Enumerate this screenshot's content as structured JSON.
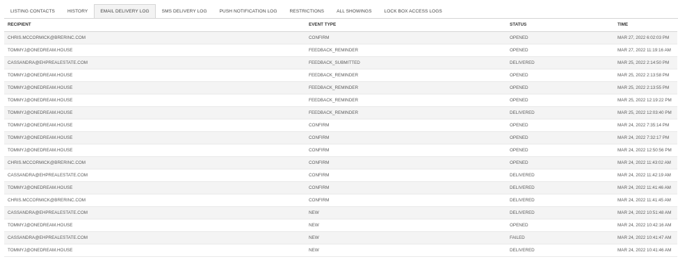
{
  "tabs": [
    {
      "label": "LISTING CONTACTS",
      "active": false
    },
    {
      "label": "HISTORY",
      "active": false
    },
    {
      "label": "EMAIL DELIVERY LOG",
      "active": true
    },
    {
      "label": "SMS DELIVERY LOG",
      "active": false
    },
    {
      "label": "PUSH NOTIFICATION LOG",
      "active": false
    },
    {
      "label": "RESTRICTIONS",
      "active": false
    },
    {
      "label": "ALL SHOWINGS",
      "active": false
    },
    {
      "label": "LOCK BOX ACCESS LOGS",
      "active": false
    }
  ],
  "table": {
    "columns": [
      "RECIPIENT",
      "EVENT TYPE",
      "STATUS",
      "TIME"
    ],
    "rows": [
      [
        "CHRIS.MCCORMICK@BRERINC.COM",
        "CONFIRM",
        "OPENED",
        "MAR 27, 2022 6:02:03 PM"
      ],
      [
        "TOMMYJ@ONEDREAM.HOUSE",
        "FEEDBACK_REMINDER",
        "OPENED",
        "MAR 27, 2022 11:19:16 AM"
      ],
      [
        "CASSANDRA@EHPREALESTATE.COM",
        "FEEDBACK_SUBMITTED",
        "DELIVERED",
        "MAR 25, 2022 2:14:50 PM"
      ],
      [
        "TOMMYJ@ONEDREAM.HOUSE",
        "FEEDBACK_REMINDER",
        "OPENED",
        "MAR 25, 2022 2:13:58 PM"
      ],
      [
        "TOMMYJ@ONEDREAM.HOUSE",
        "FEEDBACK_REMINDER",
        "OPENED",
        "MAR 25, 2022 2:13:55 PM"
      ],
      [
        "TOMMYJ@ONEDREAM.HOUSE",
        "FEEDBACK_REMINDER",
        "OPENED",
        "MAR 25, 2022 12:19:22 PM"
      ],
      [
        "TOMMYJ@ONEDREAM.HOUSE",
        "FEEDBACK_REMINDER",
        "DELIVERED",
        "MAR 25, 2022 12:03:40 PM"
      ],
      [
        "TOMMYJ@ONEDREAM.HOUSE",
        "CONFIRM",
        "OPENED",
        "MAR 24, 2022 7:35:14 PM"
      ],
      [
        "TOMMYJ@ONEDREAM.HOUSE",
        "CONFIRM",
        "OPENED",
        "MAR 24, 2022 7:32:17 PM"
      ],
      [
        "TOMMYJ@ONEDREAM.HOUSE",
        "CONFIRM",
        "OPENED",
        "MAR 24, 2022 12:50:56 PM"
      ],
      [
        "CHRIS.MCCORMICK@BRERINC.COM",
        "CONFIRM",
        "OPENED",
        "MAR 24, 2022 11:43:02 AM"
      ],
      [
        "CASSANDRA@EHPREALESTATE.COM",
        "CONFIRM",
        "DELIVERED",
        "MAR 24, 2022 11:42:19 AM"
      ],
      [
        "TOMMYJ@ONEDREAM.HOUSE",
        "CONFIRM",
        "DELIVERED",
        "MAR 24, 2022 11:41:46 AM"
      ],
      [
        "CHRIS.MCCORMICK@BRERINC.COM",
        "CONFIRM",
        "DELIVERED",
        "MAR 24, 2022 11:41:45 AM"
      ],
      [
        "CASSANDRA@EHPREALESTATE.COM",
        "NEW",
        "DELIVERED",
        "MAR 24, 2022 10:51:48 AM"
      ],
      [
        "TOMMYJ@ONEDREAM.HOUSE",
        "NEW",
        "OPENED",
        "MAR 24, 2022 10:42:16 AM"
      ],
      [
        "CASSANDRA@EHPREALESTATE.COM",
        "NEW",
        "FAILED",
        "MAR 24, 2022 10:41:47 AM"
      ],
      [
        "TOMMYJ@ONEDREAM.HOUSE",
        "NEW",
        "DELIVERED",
        "MAR 24, 2022 10:41:46 AM"
      ]
    ]
  }
}
